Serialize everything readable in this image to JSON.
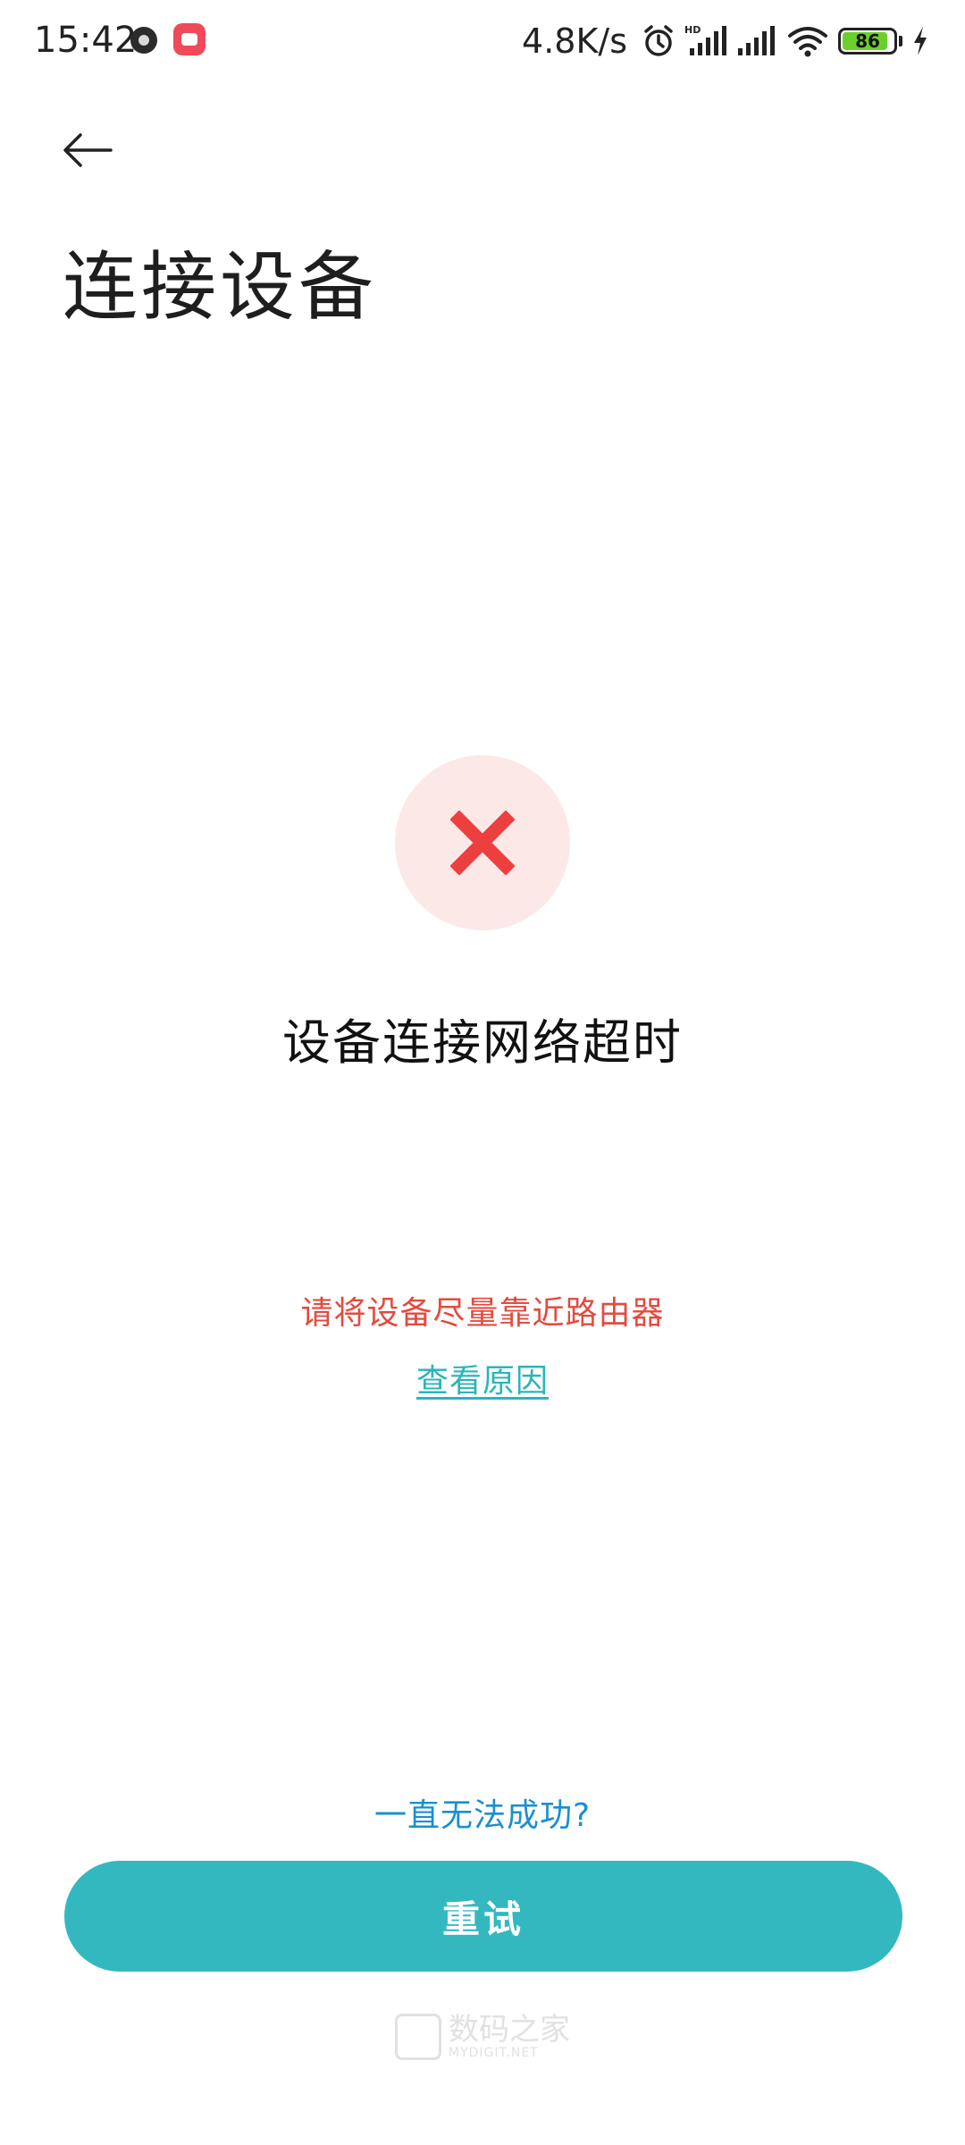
{
  "status_bar": {
    "time": "15:42",
    "network_speed": "4.8K/s",
    "battery_level": "86",
    "battery_percent": 86,
    "icons": [
      "clock-app-icon",
      "camera-app-icon",
      "alarm-icon",
      "hd-signal-icon",
      "signal-icon",
      "wifi-icon",
      "battery-icon",
      "charging-icon"
    ]
  },
  "header": {
    "back_icon": "back-arrow-icon",
    "title": "连接设备"
  },
  "main": {
    "status_icon": "error-x-icon",
    "status_title": "设备连接网络超时",
    "hint": "请将设备尽量靠近路由器",
    "reason_link": "查看原因"
  },
  "footer": {
    "help_link": "一直无法成功?",
    "retry_label": "重试",
    "watermark_main": "数码之家",
    "watermark_sub": "MYDIGIT.NET"
  },
  "colors": {
    "accent": "#34b8c0",
    "error": "#e34b3f",
    "error_bg": "#fde8e8",
    "link": "#1a8fcf"
  }
}
